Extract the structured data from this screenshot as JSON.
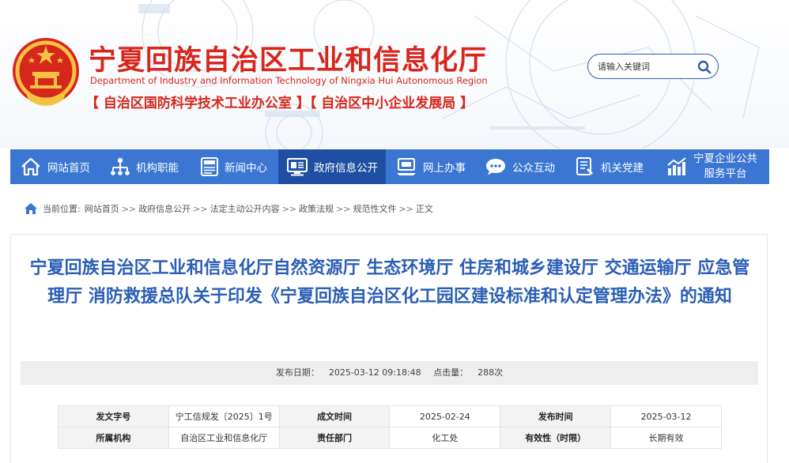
{
  "header": {
    "title": "宁夏回族自治区工业和信息化厅",
    "subtitle_en": "Department of Industry and Information Technology of Ningxia Hui Autonomous Region",
    "sub_orgs": "【 自治区国防科学技术工业办公室 】【 自治区中小企业发展局 】",
    "search_placeholder": "请输入关键词",
    "colors": {
      "brand_red": "#d7261c",
      "nav_blue": "#3a76d2",
      "nav_active": "#1f4fa3",
      "title_blue": "#2b5eb5"
    }
  },
  "nav": {
    "items": [
      {
        "label": "网站首页",
        "icon": "home-icon"
      },
      {
        "label": "机构职能",
        "icon": "org-chart-icon"
      },
      {
        "label": "新闻中心",
        "icon": "news-icon"
      },
      {
        "label": "政府信息公开",
        "icon": "monitor-icon",
        "active": true
      },
      {
        "label": "网上办事",
        "icon": "computer-service-icon"
      },
      {
        "label": "公众互动",
        "icon": "chat-bubble-icon"
      },
      {
        "label": "机关党建",
        "icon": "document-icon"
      },
      {
        "label_line1": "宁夏企业公共",
        "label_line2": "服务平台",
        "icon": "bar-chart-icon"
      }
    ]
  },
  "breadcrumb": {
    "prefix": "当前位置:",
    "items": [
      "网站首页",
      "政府信息公开",
      "法定主动公开内容",
      "政策法规",
      "规范性文件",
      "正文"
    ],
    "separator": ">>"
  },
  "article": {
    "title": "宁夏回族自治区工业和信息化厅自然资源厅 生态环境厅 住房和城乡建设厅 交通运输厅 应急管理厅 消防救援总队关于印发《宁夏回族自治区化工园区建设标准和认定管理办法》的通知",
    "publish_label": "发布日期：",
    "publish_date": "2025-03-12 09:18:48",
    "clicks_label": "点击量：",
    "clicks": "288次"
  },
  "info_table": {
    "rows": [
      [
        {
          "k": "发文字号",
          "v": "宁工信规发〔2025〕1号"
        },
        {
          "k": "成文时间",
          "v": "2025-02-24"
        },
        {
          "k": "发布时间",
          "v": "2025-03-12"
        }
      ],
      [
        {
          "k": "所属机构",
          "v": "自治区工业和信息化厅"
        },
        {
          "k": "责任部门",
          "v": "化工处"
        },
        {
          "k": "有效性（时限）",
          "v": "长期有效"
        }
      ]
    ]
  }
}
